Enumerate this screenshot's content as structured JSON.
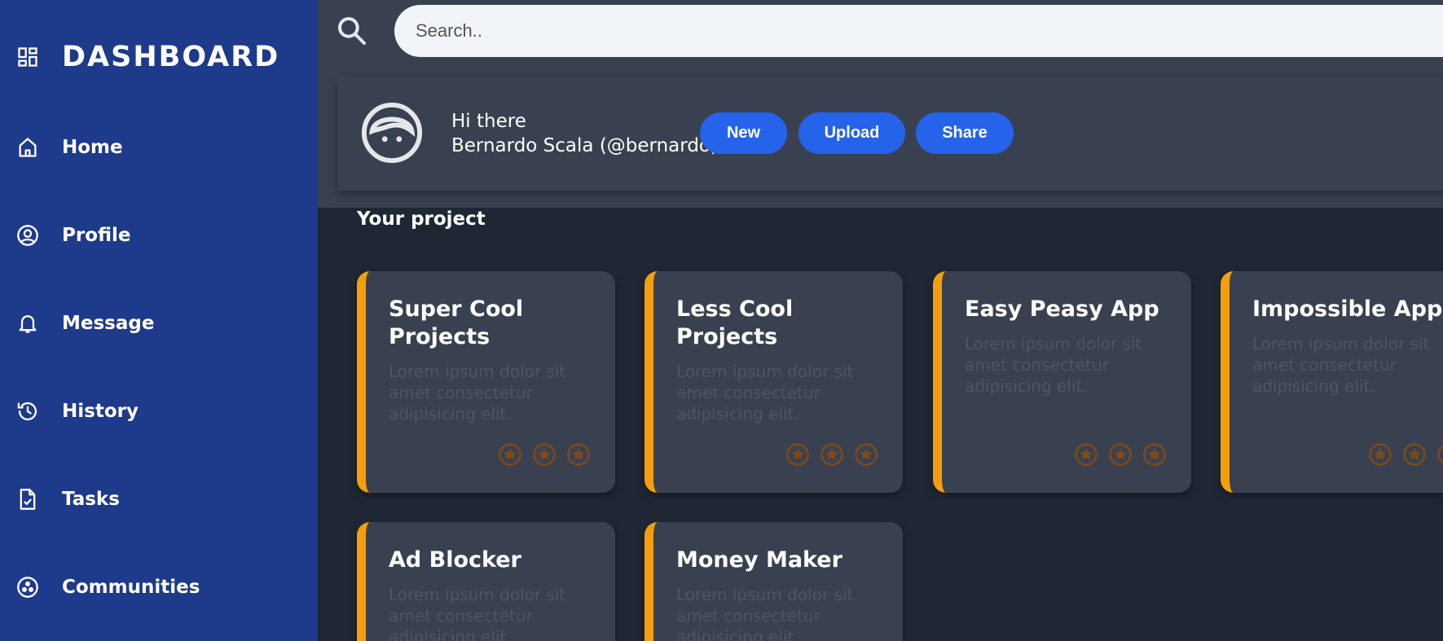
{
  "sidebar": {
    "brand": "DASHBOARD",
    "items": [
      {
        "label": "Home",
        "icon": "home-icon"
      },
      {
        "label": "Profile",
        "icon": "user-circle-icon"
      },
      {
        "label": "Message",
        "icon": "bell-icon"
      },
      {
        "label": "History",
        "icon": "history-icon"
      },
      {
        "label": "Tasks",
        "icon": "file-check-icon"
      },
      {
        "label": "Communities",
        "icon": "community-icon"
      }
    ]
  },
  "header": {
    "search_placeholder": "Search..",
    "greeting": "Hi there",
    "user": "Bernardo Scala (@bernardo)",
    "buttons": {
      "new": "New",
      "upload": "Upload",
      "share": "Share"
    }
  },
  "main": {
    "section_title": "Your project",
    "projects": [
      {
        "title": "Super Cool Projects",
        "description": "Lorem ipsum dolor sit amet consectetur adipisicing elit."
      },
      {
        "title": "Less Cool Projects",
        "description": "Lorem ipsum dolor sit amet consectetur adipisicing elit."
      },
      {
        "title": "Easy Peasy App",
        "description": "Lorem ipsum dolor sit amet consectetur adipisicing elit."
      },
      {
        "title": "Impossible App",
        "description": "Lorem ipsum dolor sit amet consectetur adipisicing elit."
      },
      {
        "title": "Ad Blocker",
        "description": "Lorem ipsum dolor sit amet consectetur adipisicing elit."
      },
      {
        "title": "Money Maker",
        "description": "Lorem ipsum dolor sit amet consectetur adipisicing elit."
      }
    ]
  },
  "colors": {
    "sidebar_bg": "#1e3a8a",
    "header_bg": "#394150",
    "content_bg": "#1f2735",
    "accent": "#f59e0b",
    "button": "#2563eb",
    "star": "#7c4a1a"
  }
}
